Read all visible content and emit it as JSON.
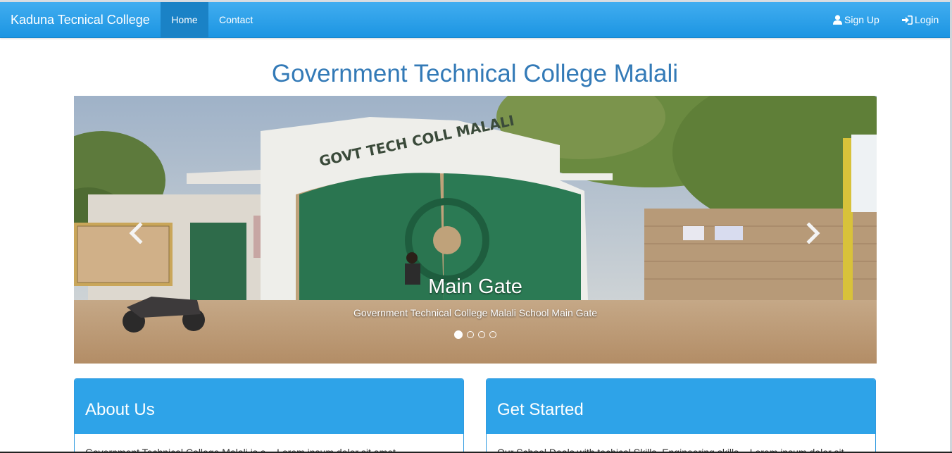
{
  "navbar": {
    "brand": "Kaduna Tecnical College",
    "links": [
      {
        "label": "Home",
        "active": true
      },
      {
        "label": "Contact",
        "active": false
      }
    ],
    "right_links": [
      {
        "label": "Sign Up",
        "icon": "user-icon"
      },
      {
        "label": "Login",
        "icon": "login-icon"
      }
    ]
  },
  "main": {
    "title": "Government Technical College Malali"
  },
  "carousel": {
    "slide_title": "Main Gate",
    "slide_caption": "Government Technical College Malali School Main Gate",
    "gate_sign_text": "GOVT TECH COLL MALALI",
    "slide_count": 4,
    "active_index": 0
  },
  "panels": [
    {
      "heading": "About Us",
      "body": "Government Technical College Malali is a... Lorem ipsum dolor sit amet"
    },
    {
      "heading": "Get Started",
      "body": "Our School Deals with techical Skills, Engineering skills... Lorem ipsum dolor sit"
    }
  ],
  "colors": {
    "navbar": "#2ea3e8",
    "navbar_active": "#1a82c6",
    "title": "#337ab7",
    "panel_heading": "#2ea3e8"
  }
}
